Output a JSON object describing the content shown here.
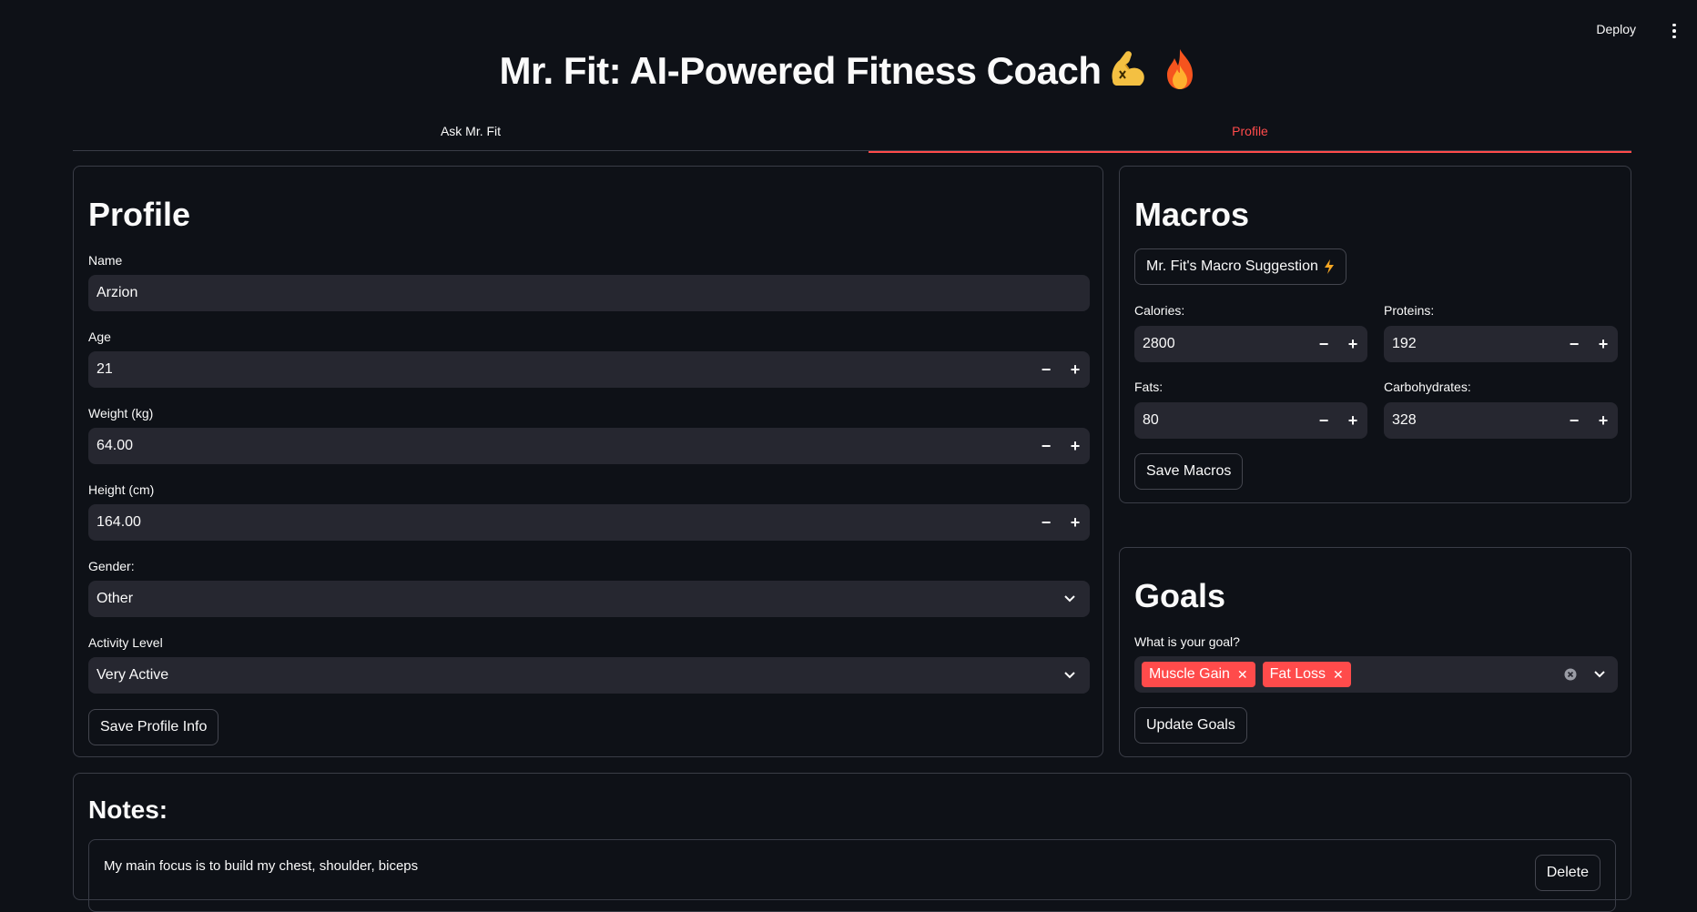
{
  "header": {
    "deploy_label": "Deploy",
    "title": "Mr. Fit: AI-Powered Fitness Coach"
  },
  "tabs": [
    {
      "label": "Ask Mr. Fit",
      "active": false
    },
    {
      "label": "Profile",
      "active": true
    }
  ],
  "profile": {
    "heading": "Profile",
    "name": {
      "label": "Name",
      "value": "Arzion"
    },
    "age": {
      "label": "Age",
      "value": "21"
    },
    "weight": {
      "label": "Weight (kg)",
      "value": "64.00"
    },
    "height": {
      "label": "Height (cm)",
      "value": "164.00"
    },
    "gender": {
      "label": "Gender:",
      "value": "Other"
    },
    "activity": {
      "label": "Activity Level",
      "value": "Very Active"
    },
    "save_label": "Save Profile Info"
  },
  "macros": {
    "heading": "Macros",
    "suggest_label": "Mr. Fit's Macro Suggestion",
    "calories": {
      "label": "Calories:",
      "value": "2800"
    },
    "proteins": {
      "label": "Proteins:",
      "value": "192"
    },
    "fats": {
      "label": "Fats:",
      "value": "80"
    },
    "carbs": {
      "label": "Carbohydrates:",
      "value": "328"
    },
    "save_label": "Save Macros"
  },
  "goals": {
    "heading": "Goals",
    "question": "What is your goal?",
    "selected": [
      "Muscle Gain",
      "Fat Loss"
    ],
    "update_label": "Update Goals"
  },
  "notes": {
    "heading": "Notes:",
    "items": [
      {
        "text": "My main focus is to build my chest, shoulder, biceps",
        "delete_label": "Delete"
      }
    ]
  },
  "colors": {
    "background": "#0e1117",
    "accent": "#ff4b4b",
    "input_bg": "#262730"
  }
}
